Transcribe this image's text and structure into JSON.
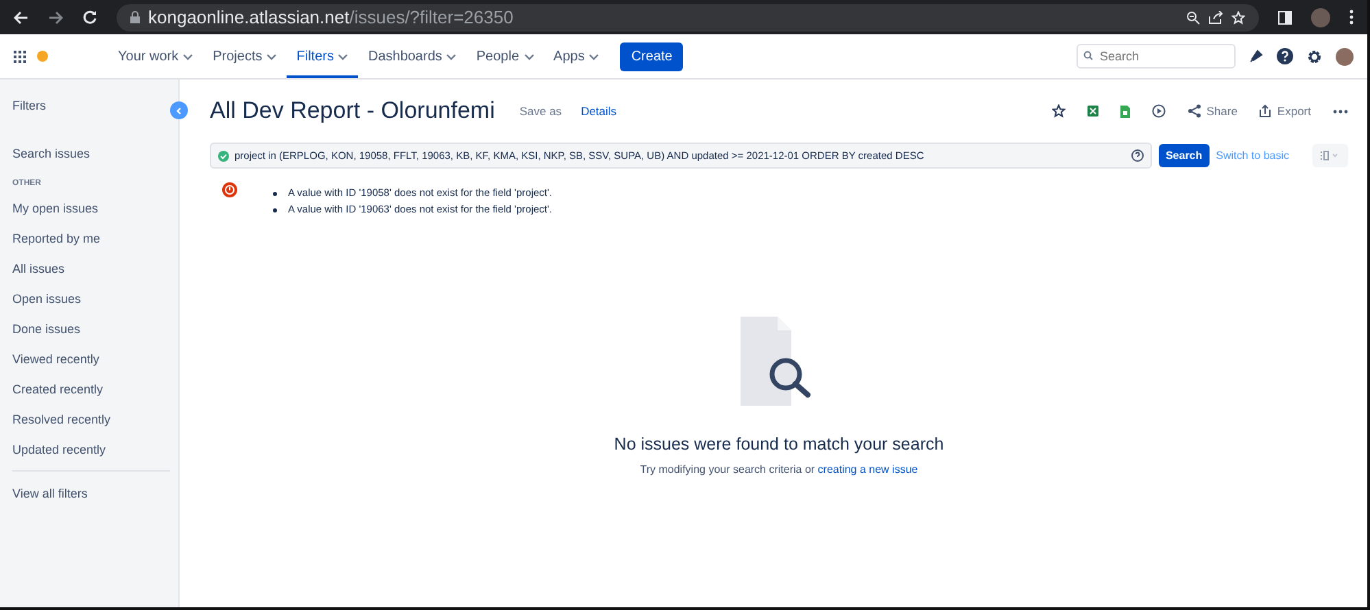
{
  "browser": {
    "url_host": "kongaonline.atlassian.net",
    "url_path": "/issues/?filter=26350"
  },
  "nav": {
    "items": [
      {
        "label": "Your work",
        "selected": false
      },
      {
        "label": "Projects",
        "selected": false
      },
      {
        "label": "Filters",
        "selected": true
      },
      {
        "label": "Dashboards",
        "selected": false
      },
      {
        "label": "People",
        "selected": false
      },
      {
        "label": "Apps",
        "selected": false
      }
    ],
    "create_button": "Create",
    "search": {
      "placeholder": "Search"
    }
  },
  "sidebar": {
    "title": "Filters",
    "top_items": [
      {
        "label": "Search issues",
        "selected": false
      }
    ],
    "section": "OTHER",
    "items": [
      {
        "label": "My open issues",
        "selected": false
      },
      {
        "label": "Reported by me",
        "selected": false
      },
      {
        "label": "All issues",
        "selected": false
      },
      {
        "label": "Open issues",
        "selected": false
      },
      {
        "label": "Done issues",
        "selected": false
      },
      {
        "label": "Viewed recently",
        "selected": false
      },
      {
        "label": "Created recently",
        "selected": false
      },
      {
        "label": "Resolved recently",
        "selected": false
      },
      {
        "label": "Updated recently",
        "selected": false
      }
    ],
    "footer_item": "View all filters"
  },
  "header": {
    "title": "All Dev Report - Olorunfemi",
    "save_as": "Save as",
    "details": "Details",
    "share": "Share",
    "export": "Export"
  },
  "query": {
    "value": "project in (ERPLOG, KON, 19058, FFLT, 19063, KB, KF, KMA, KSI, NKP, SB, SSV, SUPA, UB) AND updated >= 2021-12-01 ORDER BY created DESC",
    "valid": true,
    "search_button": "Search",
    "switch_link": "Switch to basic"
  },
  "errors": [
    "A value with ID '19058' does not exist for the field 'project'.",
    "A value with ID '19063' does not exist for the field 'project'."
  ],
  "empty_state": {
    "heading": "No issues were found to match your search",
    "text": "Try modifying your search criteria or",
    "link": "creating a new issue"
  }
}
